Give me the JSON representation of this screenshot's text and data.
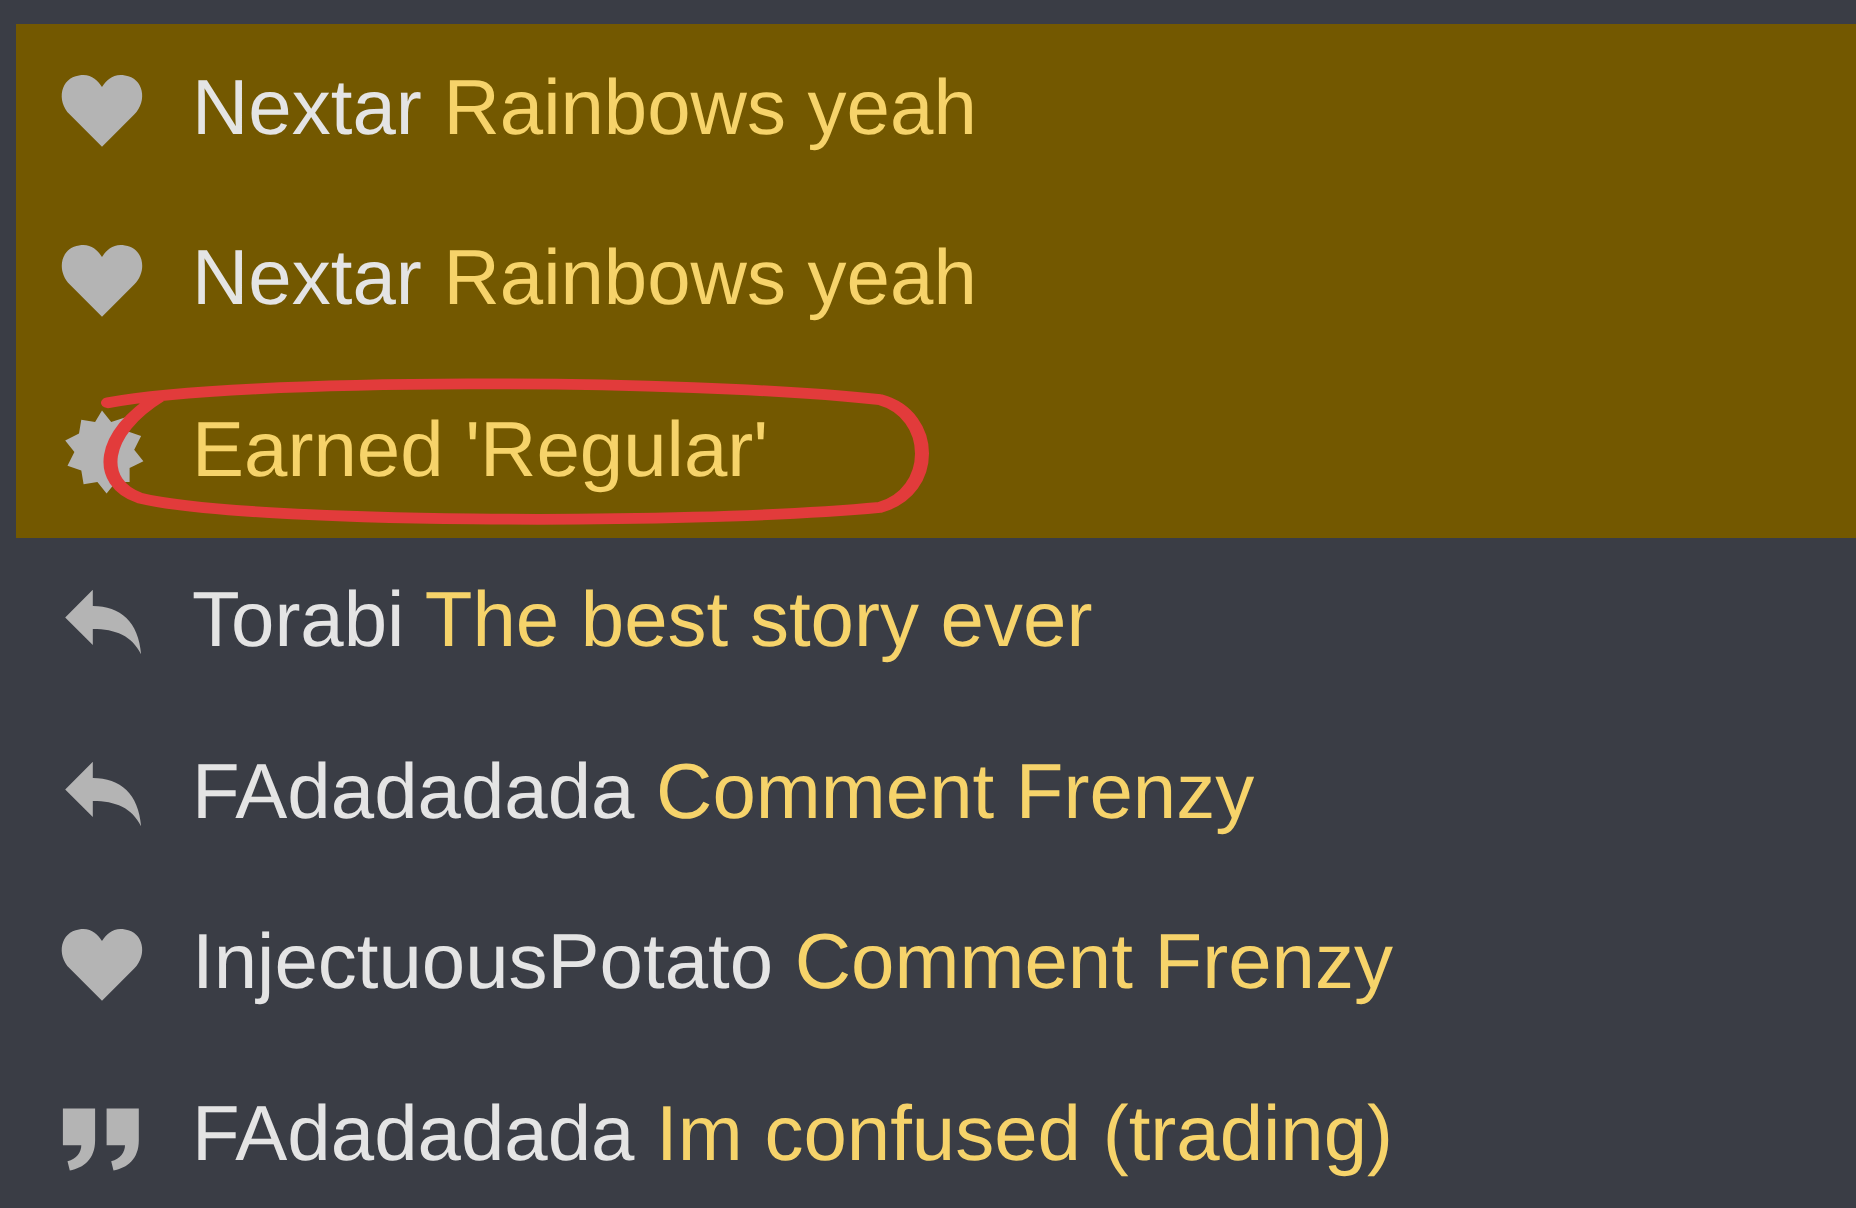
{
  "activity": [
    {
      "kind": "like",
      "user": "Nextar",
      "title": "Rainbows yeah",
      "unread": true,
      "circled": false
    },
    {
      "kind": "like",
      "user": "Nextar",
      "title": "Rainbows yeah",
      "unread": true,
      "circled": false
    },
    {
      "kind": "achievement",
      "title": "Earned 'Regular'",
      "unread": true,
      "circled": true
    },
    {
      "kind": "reply",
      "user": "Torabi",
      "title": "The best story ever",
      "unread": false,
      "circled": false
    },
    {
      "kind": "reply",
      "user": "FAdadadada",
      "title": "Comment Frenzy",
      "unread": false,
      "circled": false
    },
    {
      "kind": "like",
      "user": "InjectuousPotato",
      "title": "Comment Frenzy",
      "unread": false,
      "circled": false
    },
    {
      "kind": "quote",
      "user": "FAdadadada",
      "title": "Im confused (trading)",
      "unread": false,
      "circled": false
    }
  ]
}
